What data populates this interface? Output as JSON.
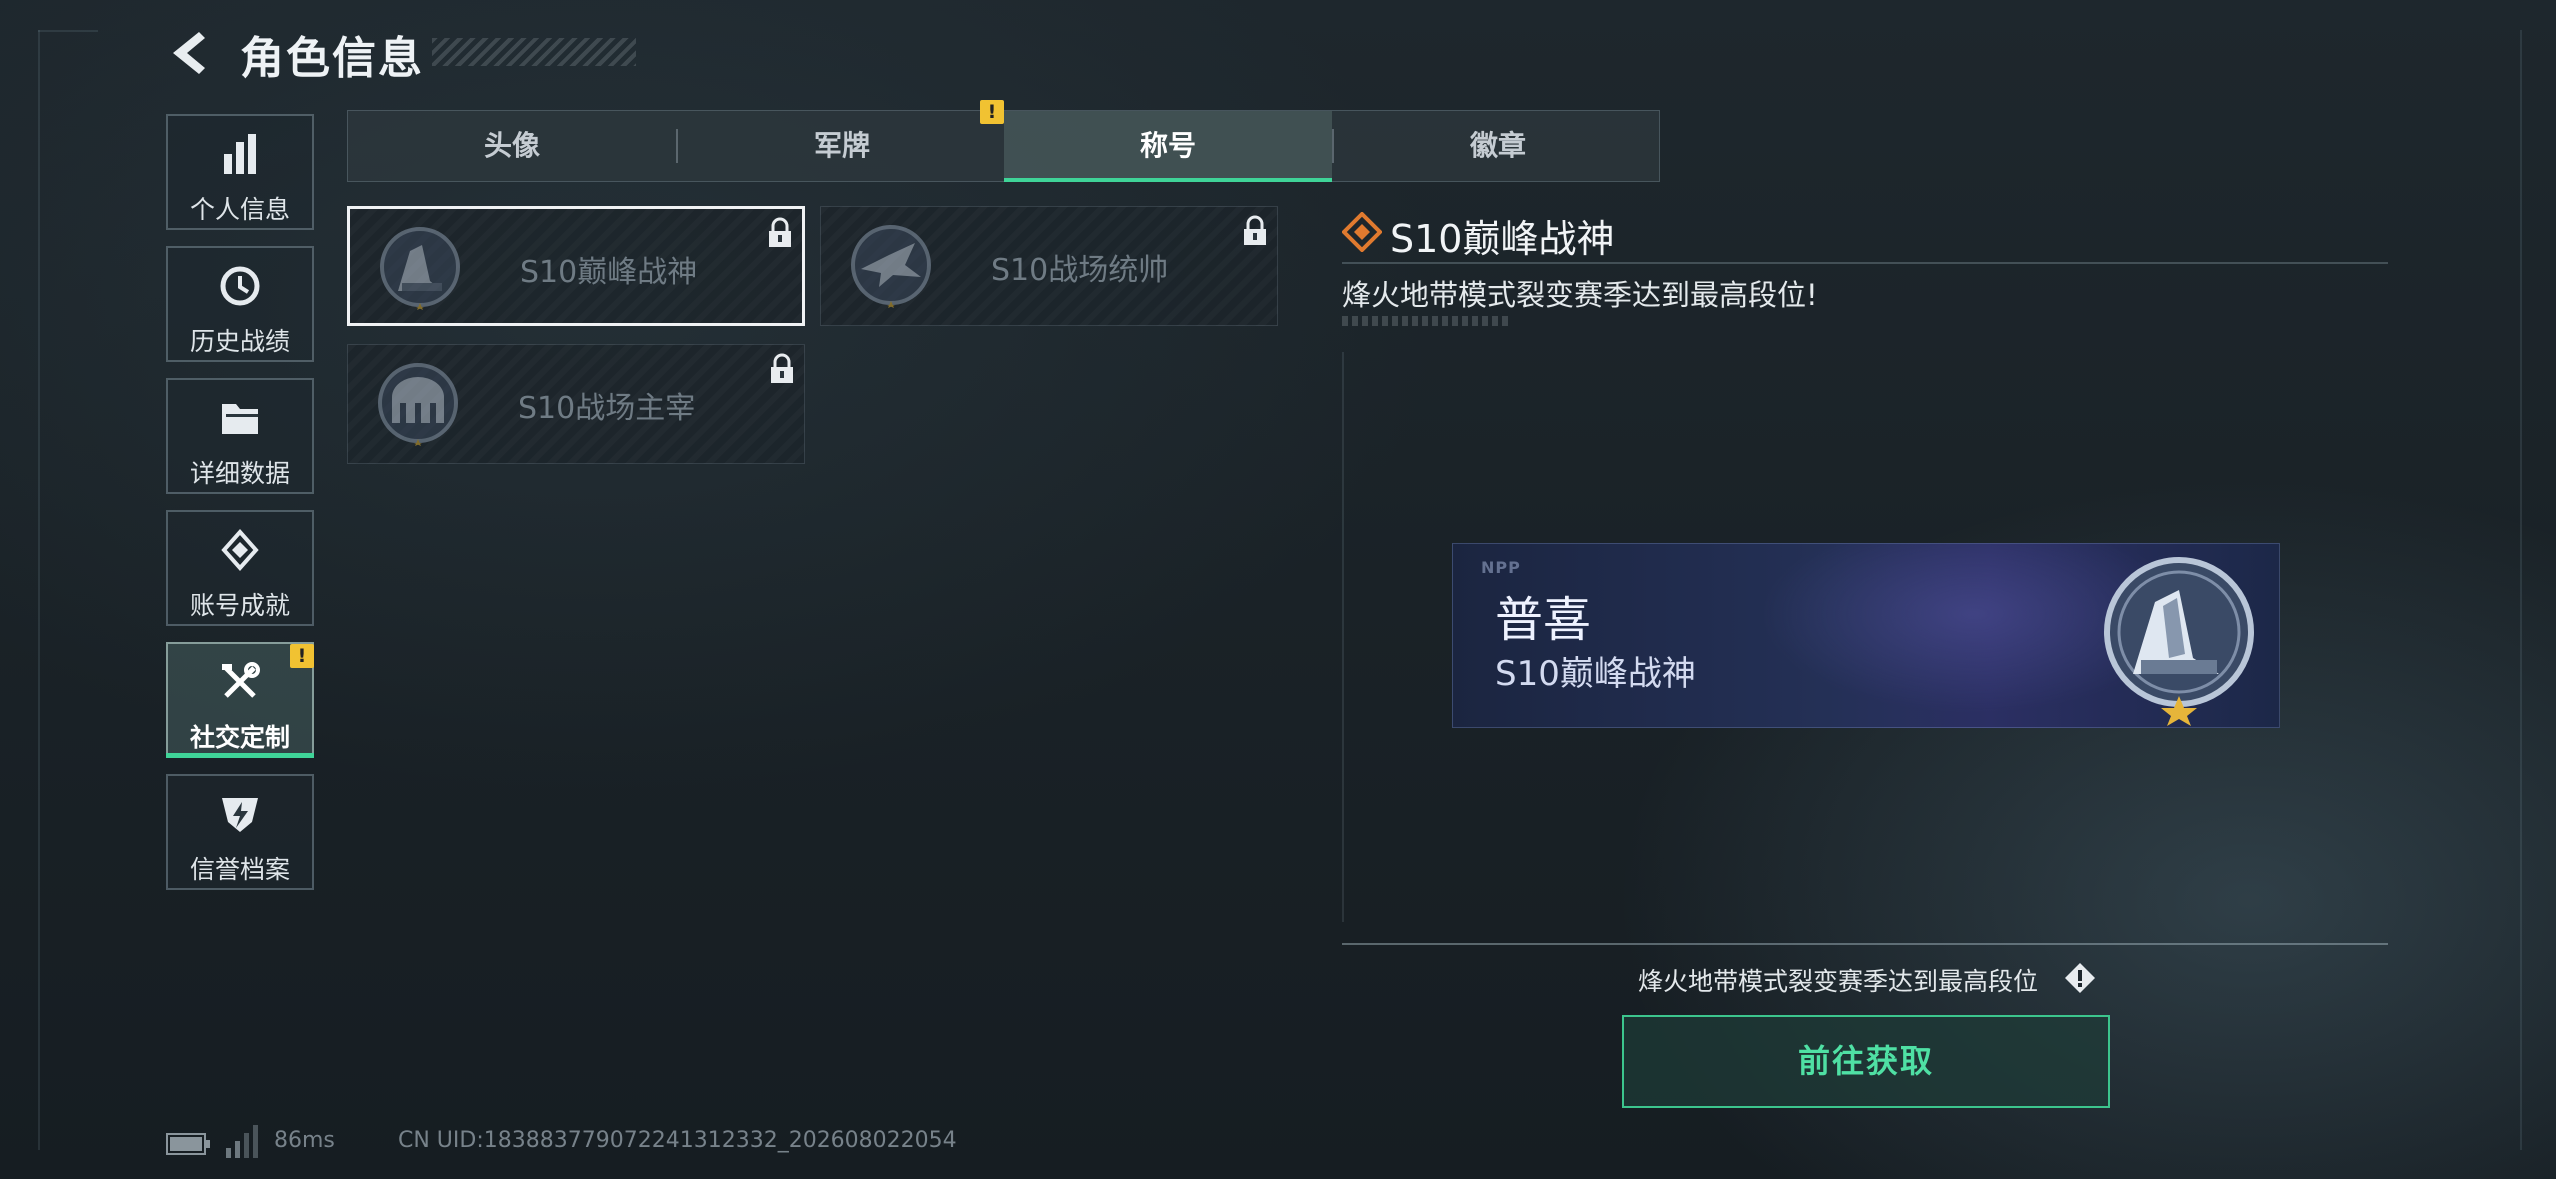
{
  "header": {
    "title": "角色信息"
  },
  "sidebar": {
    "items": [
      {
        "label": "个人信息",
        "icon": "bar-chart-icon",
        "active": false
      },
      {
        "label": "历史战绩",
        "icon": "history-clock-icon",
        "active": false
      },
      {
        "label": "详细数据",
        "icon": "folder-icon",
        "active": false
      },
      {
        "label": "账号成就",
        "icon": "medal-icon",
        "active": false
      },
      {
        "label": "社交定制",
        "icon": "tools-icon",
        "active": true,
        "alert": "!"
      },
      {
        "label": "信誉档案",
        "icon": "shield-lightning-icon",
        "active": false
      }
    ]
  },
  "tabs": {
    "items": [
      {
        "label": "头像",
        "active": false
      },
      {
        "label": "军牌",
        "active": false,
        "alert": "!"
      },
      {
        "label": "称号",
        "active": true
      },
      {
        "label": "徽章",
        "active": false
      }
    ]
  },
  "titles": {
    "items": [
      {
        "name": "S10巅峰战神",
        "selected": true,
        "locked": true,
        "emblem": "peak-war-god-emblem-icon"
      },
      {
        "name": "S10战场统帅",
        "selected": false,
        "locked": true,
        "emblem": "battlefield-commander-emblem-icon"
      },
      {
        "name": "S10战场主宰",
        "selected": false,
        "locked": true,
        "emblem": "battlefield-dominator-emblem-icon"
      }
    ]
  },
  "detail": {
    "title": "S10巅峰战神",
    "description": "烽火地带模式裂变赛季达到最高段位!",
    "icon": "diamond-rank-icon",
    "accent_color": "#e07a2f"
  },
  "nameplate": {
    "brand": "NPP",
    "player_name": "普喜",
    "title": "S10巅峰战神",
    "emblem": "peak-war-god-emblem-icon"
  },
  "requirement": {
    "text": "烽火地带模式裂变赛季达到最高段位",
    "icon": "info-diamond-icon"
  },
  "action_button": {
    "label": "前往获取",
    "color": "#4fe0a4"
  },
  "footer": {
    "ping": "86ms",
    "uid": "CN UID:18388377907224131233​2_202608022054"
  },
  "colors": {
    "accent_green": "#3fd498",
    "alert_yellow": "#f1c232"
  }
}
